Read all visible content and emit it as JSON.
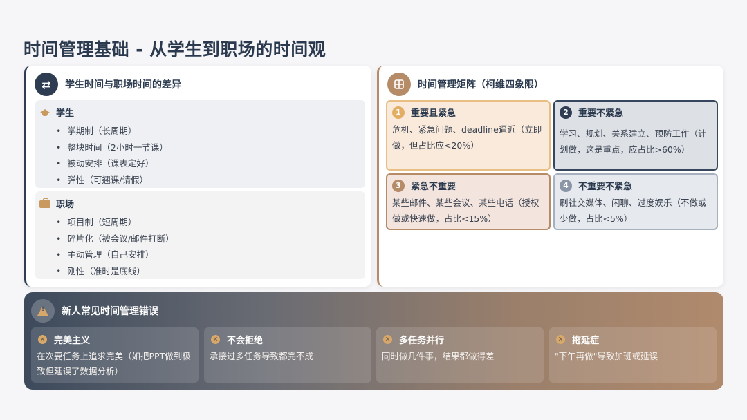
{
  "page": {
    "title": "时间管理基础 - 从学生到职场的时间观"
  },
  "left_card": {
    "title": "学生时间与职场时间的差异",
    "icon": "swap-arrows-icon",
    "groups": [
      {
        "title": "学生",
        "icon": "graduation-cap-icon",
        "items": [
          "学期制（长周期）",
          "整块时间（2小时一节课）",
          "被动安排（课表定好）",
          "弹性（可翘课/请假）"
        ]
      },
      {
        "title": "职场",
        "icon": "briefcase-icon",
        "items": [
          "项目制（短周期）",
          "碎片化（被会议/邮件打断）",
          "主动管理（自己安排）",
          "刚性（准时是底线）"
        ]
      }
    ]
  },
  "right_card": {
    "title": "时间管理矩阵（柯维四象限）",
    "icon": "grid-icon",
    "quadrants": [
      {
        "num": "1",
        "title": "重要且紧急",
        "text": "危机、紧急问题、deadline逼近（立即做，但占比应<20%）"
      },
      {
        "num": "2",
        "title": "重要不紧急",
        "text": "学习、规划、关系建立、预防工作（计划做，这是重点，应占比>60%）"
      },
      {
        "num": "3",
        "title": "紧急不重要",
        "text": "某些邮件、某些会议、某些电话（授权做或快速做，占比<15%）"
      },
      {
        "num": "4",
        "title": "不重要不紧急",
        "text": "刷社交媒体、闲聊、过度娱乐（不做或少做，占比<5%）"
      }
    ]
  },
  "mistakes": {
    "title": "新人常见时间管理错误",
    "icon": "warning-icon",
    "items": [
      {
        "title": "完美主义",
        "text": "在次要任务上追求完美（如把PPT做到极致但延误了数据分析）"
      },
      {
        "title": "不会拒绝",
        "text": "承接过多任务导致都完不成"
      },
      {
        "title": "多任务并行",
        "text": "同时做几件事，结果都做得差"
      },
      {
        "title": "拖延症",
        "text": "\"下午再做\"导致加班或延误"
      }
    ]
  }
}
